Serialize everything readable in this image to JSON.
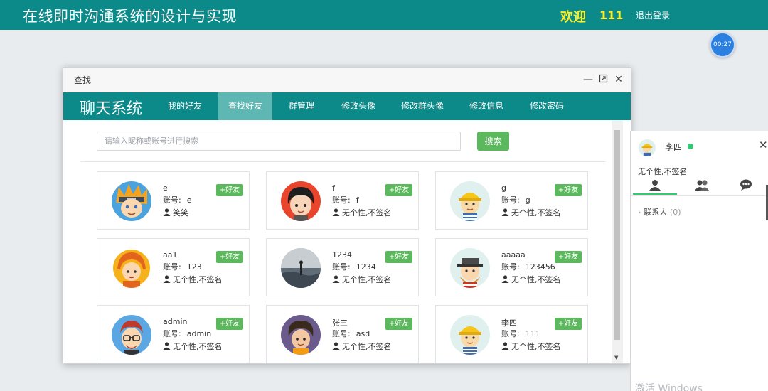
{
  "header": {
    "title": "在线即时沟通系统的设计与实现",
    "welcome": "欢迎",
    "username": "111",
    "logout": "退出登录"
  },
  "timer": "00:27",
  "window": {
    "title": "查找",
    "brand": "聊天系统",
    "nav": [
      "我的好友",
      "查找好友",
      "群管理",
      "修改头像",
      "修改群头像",
      "修改信息",
      "修改密码"
    ],
    "active_nav": "查找好友",
    "search": {
      "placeholder": "请输入昵称或账号进行搜索",
      "value": "",
      "button": "搜索"
    },
    "account_label": "账号:",
    "add_label": "+好友",
    "users": [
      {
        "nick": "e",
        "account": "e",
        "signature": "笑笑",
        "avatar": "naruto-avatar"
      },
      {
        "nick": "f",
        "account": "f",
        "signature": "无个性,不签名",
        "avatar": "boy-black-hair-avatar"
      },
      {
        "nick": "g",
        "account": "g",
        "signature": "无个性,不签名",
        "avatar": "worker-hardhat-avatar"
      },
      {
        "nick": "aa1",
        "account": "123",
        "signature": "无个性,不签名",
        "avatar": "orange-hair-girl-avatar"
      },
      {
        "nick": "1234",
        "account": "1234",
        "signature": "无个性,不签名",
        "avatar": "seaside-photo-avatar"
      },
      {
        "nick": "aaaaa",
        "account": "123456",
        "signature": "无个性,不签名",
        "avatar": "hat-beard-man-avatar"
      },
      {
        "nick": "admin",
        "account": "admin",
        "signature": "无个性,不签名",
        "avatar": "glasses-man-avatar"
      },
      {
        "nick": "张三",
        "account": "asd",
        "signature": "无个性,不签名",
        "avatar": "curly-hair-boy-avatar"
      },
      {
        "nick": "李四",
        "account": "111",
        "signature": "无个性,不签名",
        "avatar": "worker-hardhat-avatar"
      }
    ]
  },
  "side_panel": {
    "name": "李四",
    "signature": "无个性,不签名",
    "tabs": [
      "friends-tab-icon",
      "group-tab-icon",
      "chat-tab-icon"
    ],
    "contacts_label": "联系人",
    "contacts_count": "(0)"
  },
  "watermark": "激活 Windows",
  "colors": {
    "teal": "#0c8a8a",
    "active_tab": "#5fb7b3",
    "green_button": "#5cb85c",
    "welcome_yellow": "#f7ef2a",
    "online": "#2ecc71"
  }
}
